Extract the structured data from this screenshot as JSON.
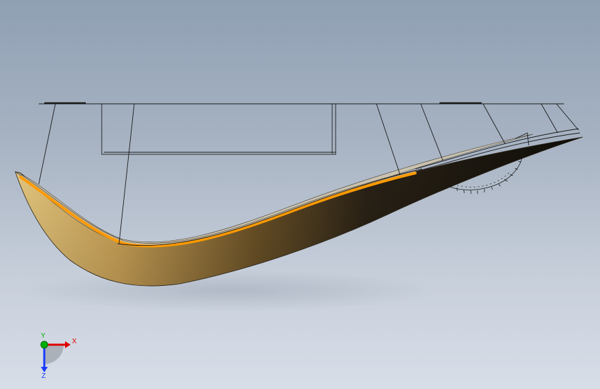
{
  "triad": {
    "x_label": "X",
    "y_label": "Y",
    "z_label": "Z"
  },
  "colors": {
    "background_top": "#8fa0b3",
    "background_bottom": "#d8dee8",
    "part_light": "#e6c77a",
    "part_dark": "#1a1610",
    "edge_highlight": "#ff9a00",
    "sketch_line": "#1a1a1a",
    "axis_x": "#e00000",
    "axis_y": "#00b000",
    "axis_z": "#1a3cff"
  }
}
